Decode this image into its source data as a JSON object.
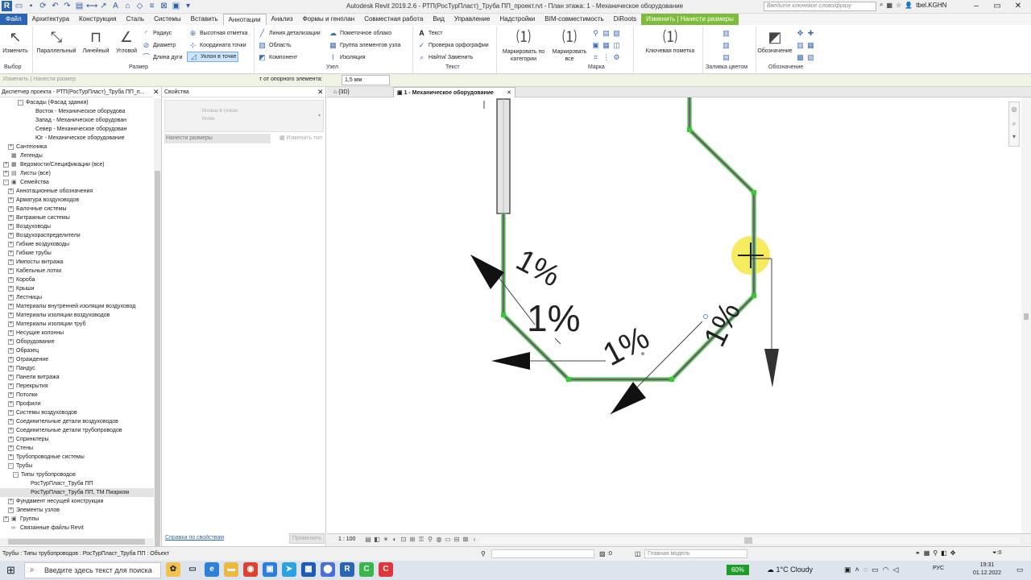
{
  "titlebar": {
    "title": "Autodesk Revit 2019.2.6 - РТП(РосТурПласт)_Труба ПП_проект.rvt - План этажа: 1 - Механическое оборудование",
    "search_placeholder": "Введите ключевое слово/фразу",
    "user": "tbel.KGHN"
  },
  "tabs": [
    "Файл",
    "Архитектура",
    "Конструкция",
    "Сталь",
    "Системы",
    "Вставить",
    "Аннотации",
    "Анализ",
    "Формы и генплан",
    "Совместная работа",
    "Вид",
    "Управление",
    "Надстройки",
    "BIM-совместимость",
    "DiRoots",
    "Изменить | Нанести размеры"
  ],
  "ribbon": {
    "modify": "Изменить",
    "aligned": "Параллельный",
    "linear": "Линейный",
    "angular": "Угловой",
    "radius": "Радиус",
    "diameter": "Диаметр",
    "arc_length": "Длина дуги",
    "spot_elevation": "Высотная отметка",
    "spot_coordinate": "Координата точки",
    "spot_slope": "Уклон  в точке",
    "detail_line": "Линия детализации",
    "region": "Область",
    "component": "Компонент",
    "revision_cloud": "Пометочное облако",
    "detail_group": "Группа элементов узла",
    "insulation": "Изоляция",
    "text": "Текст",
    "spelling": "Проверка  орфографии",
    "find_replace": "Найти/ Заменить",
    "tag_by_category": "Маркировать по категории",
    "tag_all": "Маркировать все",
    "keynote": "Ключевая пометка",
    "symbol": "Обозначение",
    "panels": {
      "select": "Выбор",
      "dimension": "Размер",
      "detail": "Узел",
      "text": "Текст",
      "tag": "Марка",
      "color_fill": "Заливка цветом",
      "symbol": "Обозначение"
    }
  },
  "optionsbar": {
    "context": "Изменить | Нанести размер",
    "label": "т от опорного элемента:",
    "value": "1,5 мм"
  },
  "browser": {
    "title": "Диспетчер проекта - РТП(РосТурПласт)_Труба ПП_п...",
    "items": [
      {
        "label": "Фасады (Фасад здания)",
        "depth": 3,
        "exp": "-",
        "icon": ""
      },
      {
        "label": "Восток - Механическое оборудова",
        "depth": 5,
        "exp": "",
        "icon": ""
      },
      {
        "label": "Запад - Механическое оборудован",
        "depth": 5,
        "exp": "",
        "icon": ""
      },
      {
        "label": "Север - Механическое оборудован",
        "depth": 5,
        "exp": "",
        "icon": ""
      },
      {
        "label": "Юг - Механическое оборудование",
        "depth": 5,
        "exp": "",
        "icon": ""
      },
      {
        "label": "Сантехника",
        "depth": 1,
        "exp": "+",
        "icon": ""
      },
      {
        "label": "Легенды",
        "depth": 0,
        "exp": "",
        "icon": "▦"
      },
      {
        "label": "Ведомости/Спецификации (все)",
        "depth": 0,
        "exp": "+",
        "icon": "▦"
      },
      {
        "label": "Листы (все)",
        "depth": 0,
        "exp": "+",
        "icon": "▤"
      },
      {
        "label": "Семейства",
        "depth": 0,
        "exp": "-",
        "icon": "▣"
      },
      {
        "label": "Аннотационные обозначения",
        "depth": 1,
        "exp": "+",
        "icon": ""
      },
      {
        "label": "Арматура воздуховодов",
        "depth": 1,
        "exp": "+",
        "icon": ""
      },
      {
        "label": "Балочные системы",
        "depth": 1,
        "exp": "+",
        "icon": ""
      },
      {
        "label": "Витражные системы",
        "depth": 1,
        "exp": "+",
        "icon": ""
      },
      {
        "label": "Воздуховоды",
        "depth": 1,
        "exp": "+",
        "icon": ""
      },
      {
        "label": "Воздухораспределители",
        "depth": 1,
        "exp": "+",
        "icon": ""
      },
      {
        "label": "Гибкие воздуховоды",
        "depth": 1,
        "exp": "+",
        "icon": ""
      },
      {
        "label": "Гибкие трубы",
        "depth": 1,
        "exp": "+",
        "icon": ""
      },
      {
        "label": "Импосты витража",
        "depth": 1,
        "exp": "+",
        "icon": ""
      },
      {
        "label": "Кабельные лотки",
        "depth": 1,
        "exp": "+",
        "icon": ""
      },
      {
        "label": "Короба",
        "depth": 1,
        "exp": "+",
        "icon": ""
      },
      {
        "label": "Крыши",
        "depth": 1,
        "exp": "+",
        "icon": ""
      },
      {
        "label": "Лестницы",
        "depth": 1,
        "exp": "+",
        "icon": ""
      },
      {
        "label": "Материалы внутренней изоляции воздуховод",
        "depth": 1,
        "exp": "+",
        "icon": ""
      },
      {
        "label": "Материалы изоляции воздуховодов",
        "depth": 1,
        "exp": "+",
        "icon": ""
      },
      {
        "label": "Материалы изоляции труб",
        "depth": 1,
        "exp": "+",
        "icon": ""
      },
      {
        "label": "Несущие колонны",
        "depth": 1,
        "exp": "+",
        "icon": ""
      },
      {
        "label": "Оборудование",
        "depth": 1,
        "exp": "+",
        "icon": ""
      },
      {
        "label": "Образец",
        "depth": 1,
        "exp": "+",
        "icon": ""
      },
      {
        "label": "Ограждение",
        "depth": 1,
        "exp": "+",
        "icon": ""
      },
      {
        "label": "Пандус",
        "depth": 1,
        "exp": "+",
        "icon": ""
      },
      {
        "label": "Панели витража",
        "depth": 1,
        "exp": "+",
        "icon": ""
      },
      {
        "label": "Перекрытия",
        "depth": 1,
        "exp": "+",
        "icon": ""
      },
      {
        "label": "Потолки",
        "depth": 1,
        "exp": "+",
        "icon": ""
      },
      {
        "label": "Профили",
        "depth": 1,
        "exp": "+",
        "icon": ""
      },
      {
        "label": "Системы воздуховодов",
        "depth": 1,
        "exp": "+",
        "icon": ""
      },
      {
        "label": "Соединительные детали воздуховодов",
        "depth": 1,
        "exp": "+",
        "icon": ""
      },
      {
        "label": "Соединительные детали трубопроводов",
        "depth": 1,
        "exp": "+",
        "icon": ""
      },
      {
        "label": "Спринклеры",
        "depth": 1,
        "exp": "+",
        "icon": ""
      },
      {
        "label": "Стены",
        "depth": 1,
        "exp": "+",
        "icon": ""
      },
      {
        "label": "Трубопроводные системы",
        "depth": 1,
        "exp": "+",
        "icon": ""
      },
      {
        "label": "Трубы",
        "depth": 1,
        "exp": "-",
        "icon": ""
      },
      {
        "label": "Типы трубопроводов",
        "depth": 2,
        "exp": "-",
        "icon": ""
      },
      {
        "label": "РосТурПласт_Труба ПП",
        "depth": 4,
        "exp": "",
        "icon": ""
      },
      {
        "label": "РосТурПласт_Труба ПП, ТМ Пиарком",
        "depth": 4,
        "exp": "",
        "icon": "",
        "selected": true
      },
      {
        "label": "Фундамент несущей конструкции",
        "depth": 1,
        "exp": "+",
        "icon": ""
      },
      {
        "label": "Элементы узлов",
        "depth": 1,
        "exp": "+",
        "icon": ""
      },
      {
        "label": "Группы",
        "depth": 0,
        "exp": "+",
        "icon": "▣"
      },
      {
        "label": "Связанные файлы Revit",
        "depth": 0,
        "exp": "",
        "icon": "∞"
      }
    ]
  },
  "properties": {
    "title": "Свойства",
    "type_line1": "Уклоны в точках",
    "type_line2": "Уклон",
    "row_label": "Нанести размеры",
    "edit_type": "Изменить тип",
    "help": "Справка по свойствам",
    "apply": "Применить"
  },
  "viewtabs": {
    "tab1": "{3D}",
    "tab2": "1 - Механическое оборудование"
  },
  "canvas": {
    "labels": [
      "1%",
      "1%",
      "1%",
      "1%"
    ]
  },
  "viewctrl": {
    "scale": "1 : 100"
  },
  "status": {
    "message": "Трубы : Типы трубопроводов : РосТурПласт_Труба ПП : Объект",
    "zero": ":0",
    "model": "Главная модель"
  },
  "taskbar": {
    "search": "Введите здесь текст для поиска",
    "battery": "60%",
    "weather": "1°C  Cloudy",
    "lang": "РУС",
    "time": "19:31",
    "date": "01.12.2022"
  },
  "colors": {
    "file_tab": "#2a64b4",
    "context_tab": "#7dbb3a",
    "options_bar": "#eef3e4",
    "selection_highlight": "#7de87d",
    "cursor_highlight": "#f5e642"
  }
}
